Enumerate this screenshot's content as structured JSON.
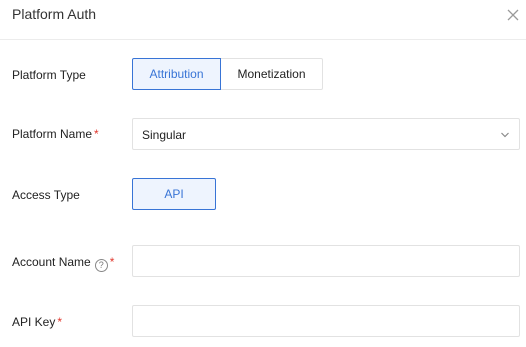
{
  "dialog": {
    "title": "Platform Auth"
  },
  "platform_type": {
    "label": "Platform Type",
    "options": [
      "Attribution",
      "Monetization"
    ],
    "selected": "Attribution"
  },
  "platform_name": {
    "label": "Platform Name",
    "required_mark": "*",
    "value": "Singular"
  },
  "access_type": {
    "label": "Access Type",
    "options": [
      "API"
    ],
    "selected": "API"
  },
  "account_name": {
    "label": "Account Name",
    "help_mark": "?",
    "required_mark": "*",
    "value": ""
  },
  "api_key": {
    "label": "API Key",
    "required_mark": "*",
    "value": ""
  },
  "colors": {
    "accent": "#3874d6",
    "accent_bg": "#eef4fe",
    "required": "#e0362c",
    "border": "#e2e2e2"
  }
}
